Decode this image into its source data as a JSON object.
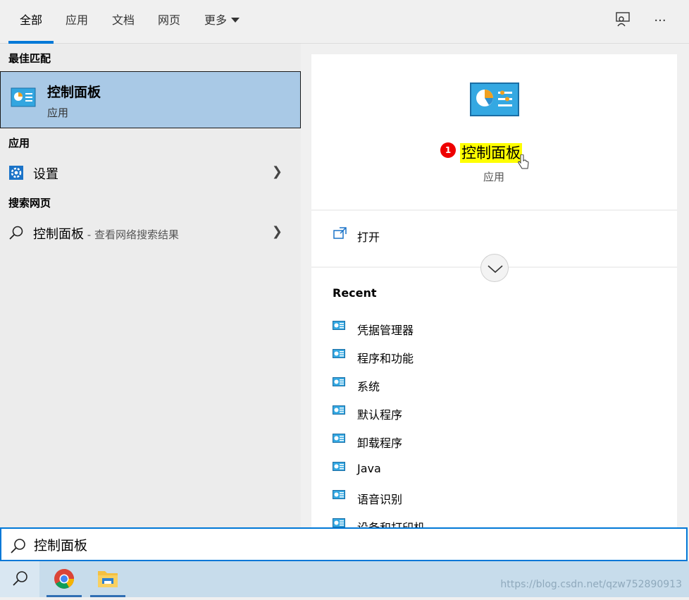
{
  "tabs": [
    {
      "label": "全部",
      "active": true
    },
    {
      "label": "应用"
    },
    {
      "label": "文档"
    },
    {
      "label": "网页"
    },
    {
      "label": "更多"
    }
  ],
  "topbar_icons": {
    "feedback": "feedback-icon",
    "more": "···"
  },
  "left": {
    "best_match_title": "最佳匹配",
    "best_match": {
      "name": "控制面板",
      "type": "应用",
      "icon": "control-panel-icon"
    },
    "apps_title": "应用",
    "apps": [
      {
        "label": "设置",
        "icon": "gear-icon"
      }
    ],
    "web_title": "搜索网页",
    "web": [
      {
        "label": "控制面板",
        "hint": " - 查看网络搜索结果",
        "icon": "search-icon"
      }
    ]
  },
  "preview": {
    "badge": "1",
    "title": "控制面板",
    "subtitle": "应用",
    "open_label": "打开",
    "recent_title": "Recent",
    "recent": [
      "凭据管理器",
      "程序和功能",
      "系统",
      "默认程序",
      "卸载程序",
      "Java",
      "语音识别",
      "设备和打印机"
    ]
  },
  "search": {
    "value": "控制面板"
  },
  "watermark": "https://blog.csdn.net/qzw752890913",
  "colors": {
    "accent": "#0078d7",
    "selected": "#a9c9e6",
    "highlight": "#ffff00",
    "badge": "#e00000"
  }
}
